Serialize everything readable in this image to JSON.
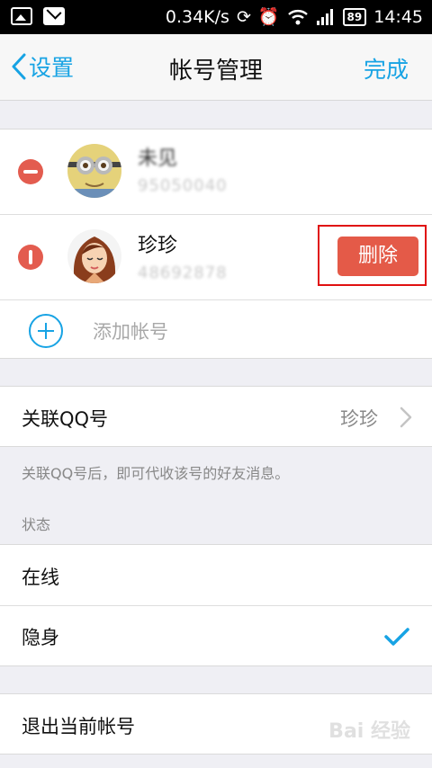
{
  "status_bar": {
    "speed": "0.34K/s",
    "battery": "89",
    "time": "14:45",
    "icons": [
      "image-icon",
      "mail-icon",
      "sync-icon",
      "alarm-icon",
      "wifi-icon",
      "signal-icon",
      "battery-icon"
    ]
  },
  "nav": {
    "back_label": "设置",
    "title": "帐号管理",
    "done_label": "完成"
  },
  "accounts": [
    {
      "name": "未见",
      "number": "95050040",
      "avatar": "minion-avatar"
    },
    {
      "name": "珍珍",
      "number": "48692878",
      "avatar": "girl-avatar"
    }
  ],
  "delete_label": "删除",
  "add_account_label": "添加帐号",
  "linked_qq": {
    "label": "关联QQ号",
    "value": "珍珍",
    "hint": "关联QQ号后，即可代收该号的好友消息。"
  },
  "status_section": {
    "header": "状态",
    "options": [
      "在线",
      "隐身"
    ],
    "selected": "隐身"
  },
  "logout_label": "退出当前帐号",
  "watermark": "Bai 经验",
  "colors": {
    "accent": "#17a3e4",
    "danger": "#e45a48",
    "background": "#efeff4"
  }
}
